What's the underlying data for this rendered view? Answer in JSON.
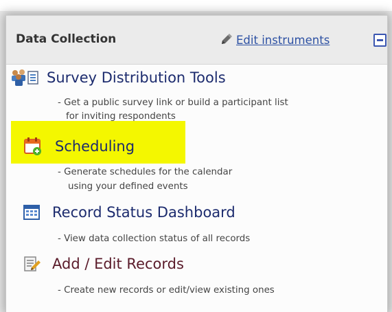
{
  "panel": {
    "title": "Data Collection",
    "edit_link": "Edit instruments",
    "collapse_icon": "collapse-minus-icon"
  },
  "items": [
    {
      "label": "Survey Distribution Tools",
      "icon": "survey-distribution-icon",
      "desc_line1": "- Get a public survey link or build a participant list",
      "desc_line2": "for inviting respondents"
    },
    {
      "label": "Scheduling",
      "icon": "calendar-add-icon",
      "desc_line1": "- Generate schedules for the calendar",
      "desc_line2": "using your defined events",
      "highlight_color": "#f4f700"
    },
    {
      "label": "Record Status Dashboard",
      "icon": "dashboard-grid-icon",
      "desc_line1": "- View data collection status of all records"
    },
    {
      "label": "Add / Edit Records",
      "icon": "edit-records-icon",
      "desc_line1": "- Create new records or edit/view existing ones"
    }
  ],
  "colors": {
    "link_blue": "#2d51a3",
    "item_label": "#1c2b6e",
    "header_bg": "#ebebeb",
    "highlight": "#f4f700"
  }
}
